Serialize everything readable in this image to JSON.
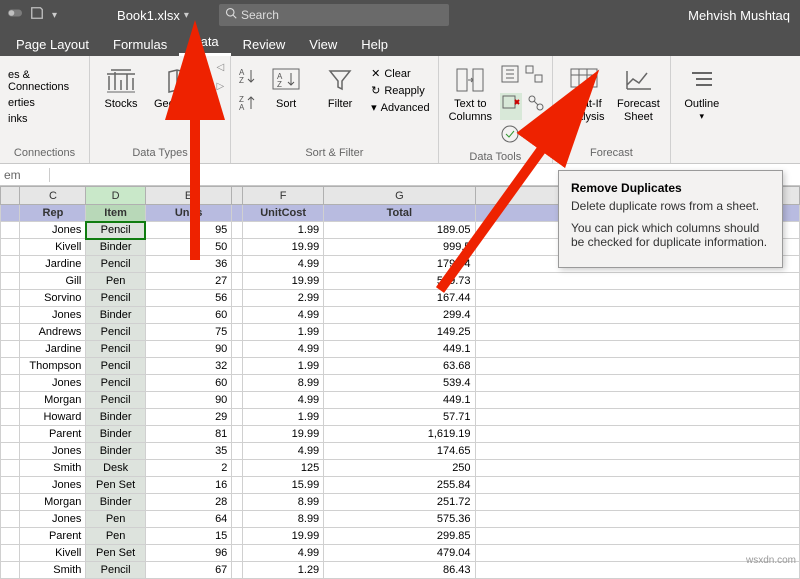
{
  "titlebar": {
    "filename": "Book1.xlsx",
    "search_placeholder": "Search",
    "username": "Mehvish Mushtaq"
  },
  "tabs": [
    "Page Layout",
    "Formulas",
    "Data",
    "Review",
    "View",
    "Help"
  ],
  "active_tab": "Data",
  "ribbon": {
    "conn": {
      "l1": "es & Connections",
      "l2": "erties",
      "l3": "inks",
      "label": "Connections"
    },
    "datatypes": {
      "stocks": "Stocks",
      "geography": "Geography",
      "label": "Data Types"
    },
    "sortfilter": {
      "sort": "Sort",
      "filter": "Filter",
      "clear": "Clear",
      "reapply": "Reapply",
      "advanced": "Advanced",
      "label": "Sort & Filter"
    },
    "datatools": {
      "ttc": "Text to\nColumns",
      "label": "Data Tools"
    },
    "forecast": {
      "whatif": "What-If\nAnalysis",
      "sheet": "Forecast\nSheet",
      "label": "Forecast"
    },
    "outline": {
      "outline": "Outline"
    }
  },
  "namebox": "em",
  "columns": [
    "",
    "C",
    "D",
    "E",
    "",
    "F",
    "G",
    ""
  ],
  "col_sel_index": 2,
  "headers": [
    "",
    "Rep",
    "Item",
    "Units",
    "",
    "UnitCost",
    "Total",
    ""
  ],
  "rows": [
    [
      "",
      "Jones",
      "Pencil",
      "95",
      "",
      "1.99",
      "189.05",
      ""
    ],
    [
      "",
      "Kivell",
      "Binder",
      "50",
      "",
      "19.99",
      "999.5",
      ""
    ],
    [
      "",
      "Jardine",
      "Pencil",
      "36",
      "",
      "4.99",
      "179.64",
      ""
    ],
    [
      "",
      "Gill",
      "Pen",
      "27",
      "",
      "19.99",
      "539.73",
      ""
    ],
    [
      "",
      "Sorvino",
      "Pencil",
      "56",
      "",
      "2.99",
      "167.44",
      ""
    ],
    [
      "",
      "Jones",
      "Binder",
      "60",
      "",
      "4.99",
      "299.4",
      ""
    ],
    [
      "",
      "Andrews",
      "Pencil",
      "75",
      "",
      "1.99",
      "149.25",
      ""
    ],
    [
      "",
      "Jardine",
      "Pencil",
      "90",
      "",
      "4.99",
      "449.1",
      ""
    ],
    [
      "",
      "Thompson",
      "Pencil",
      "32",
      "",
      "1.99",
      "63.68",
      ""
    ],
    [
      "",
      "Jones",
      "Pencil",
      "60",
      "",
      "8.99",
      "539.4",
      ""
    ],
    [
      "",
      "Morgan",
      "Pencil",
      "90",
      "",
      "4.99",
      "449.1",
      ""
    ],
    [
      "",
      "Howard",
      "Binder",
      "29",
      "",
      "1.99",
      "57.71",
      ""
    ],
    [
      "",
      "Parent",
      "Binder",
      "81",
      "",
      "19.99",
      "1,619.19",
      ""
    ],
    [
      "",
      "Jones",
      "Binder",
      "35",
      "",
      "4.99",
      "174.65",
      ""
    ],
    [
      "",
      "Smith",
      "Desk",
      "2",
      "",
      "125",
      "250",
      ""
    ],
    [
      "",
      "Jones",
      "Pen Set",
      "16",
      "",
      "15.99",
      "255.84",
      ""
    ],
    [
      "",
      "Morgan",
      "Binder",
      "28",
      "",
      "8.99",
      "251.72",
      ""
    ],
    [
      "",
      "Jones",
      "Pen",
      "64",
      "",
      "8.99",
      "575.36",
      ""
    ],
    [
      "",
      "Parent",
      "Pen",
      "15",
      "",
      "19.99",
      "299.85",
      ""
    ],
    [
      "",
      "Kivell",
      "Pen Set",
      "96",
      "",
      "4.99",
      "479.04",
      ""
    ],
    [
      "",
      "Smith",
      "Pencil",
      "67",
      "",
      "1.29",
      "86.43",
      ""
    ]
  ],
  "tooltip": {
    "title": "Remove Duplicates",
    "p1": "Delete duplicate rows from a sheet.",
    "p2": "You can pick which columns should be checked for duplicate information."
  },
  "watermark": "wsxdn.com"
}
